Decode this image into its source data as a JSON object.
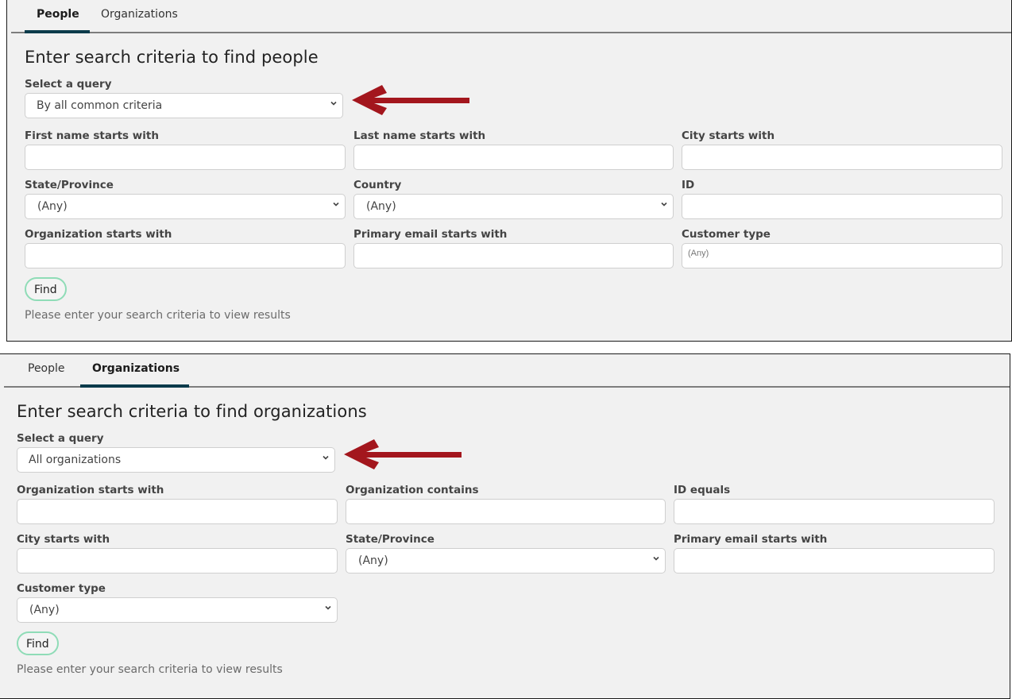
{
  "colors": {
    "panel_bg": "#f1f1f1",
    "tab_active_underline": "#0b3b4b",
    "arrow": "#a3161d",
    "find_button_border": "#8fdcb7"
  },
  "people_panel": {
    "tabs": [
      {
        "label": "People",
        "active": true
      },
      {
        "label": "Organizations",
        "active": false
      }
    ],
    "title": "Enter search criteria to find people",
    "query": {
      "label": "Select a query",
      "value": "By all common criteria"
    },
    "fields": [
      {
        "label": "First name starts with",
        "type": "text",
        "value": ""
      },
      {
        "label": "Last name starts with",
        "type": "text",
        "value": ""
      },
      {
        "label": "City starts with",
        "type": "text",
        "value": ""
      },
      {
        "label": "State/Province",
        "type": "select",
        "value": "(Any)"
      },
      {
        "label": "Country",
        "type": "select",
        "value": "(Any)"
      },
      {
        "label": "ID",
        "type": "text",
        "value": ""
      },
      {
        "label": "Organization starts with",
        "type": "text",
        "value": ""
      },
      {
        "label": "Primary email starts with",
        "type": "text",
        "value": ""
      },
      {
        "label": "Customer type",
        "type": "text",
        "placeholder": "(Any)"
      }
    ],
    "find_label": "Find",
    "hint": "Please enter your search criteria to view results"
  },
  "orgs_panel": {
    "tabs": [
      {
        "label": "People",
        "active": false
      },
      {
        "label": "Organizations",
        "active": true
      }
    ],
    "title": "Enter search criteria to find organizations",
    "query": {
      "label": "Select a query",
      "value": "All organizations"
    },
    "fields": [
      {
        "label": "Organization starts with",
        "type": "text",
        "value": ""
      },
      {
        "label": "Organization contains",
        "type": "text",
        "value": ""
      },
      {
        "label": "ID equals",
        "type": "text",
        "value": ""
      },
      {
        "label": "City starts with",
        "type": "text",
        "value": ""
      },
      {
        "label": "State/Province",
        "type": "select",
        "value": "(Any)"
      },
      {
        "label": "Primary email starts with",
        "type": "text",
        "value": ""
      },
      {
        "label": "Customer type",
        "type": "select",
        "value": "(Any)"
      }
    ],
    "find_label": "Find",
    "hint": "Please enter your search criteria to view results"
  }
}
